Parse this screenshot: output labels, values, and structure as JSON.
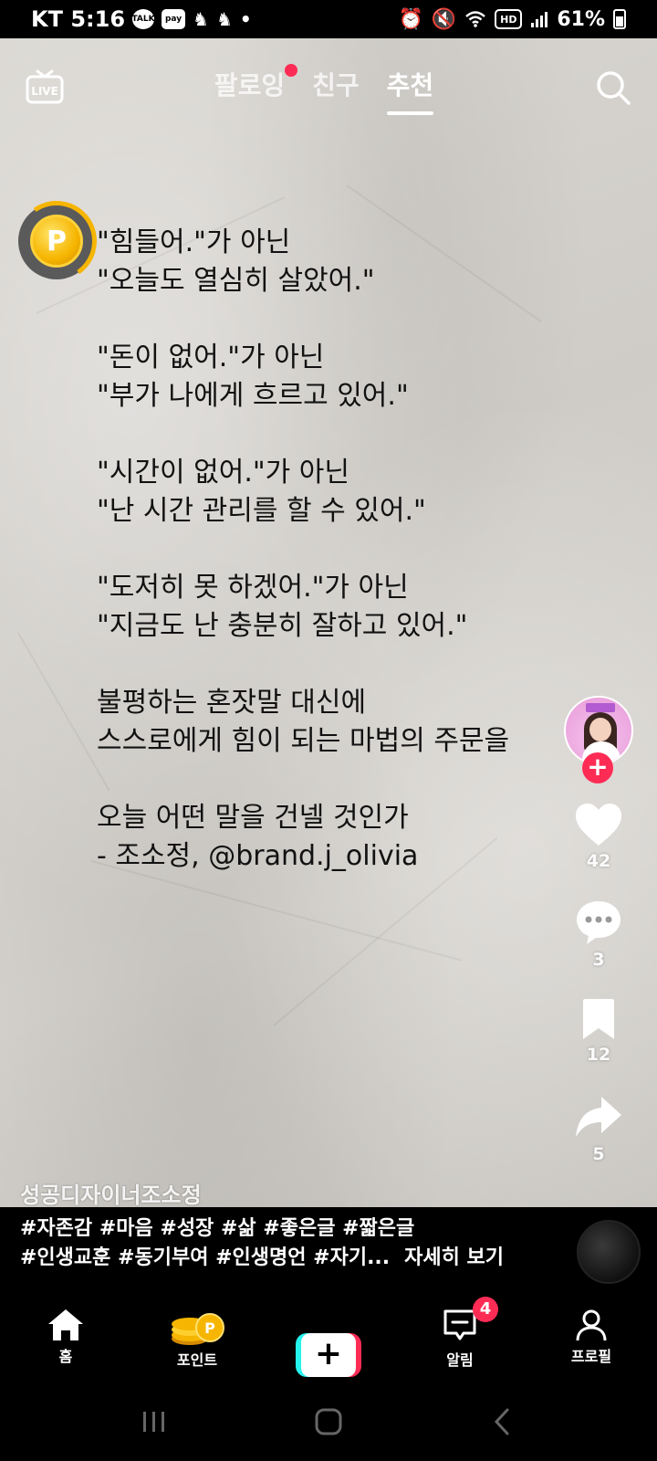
{
  "status_bar": {
    "carrier_time": "KT 5:16",
    "icons_left": [
      "talk-icon",
      "pay-icon",
      "game-icon",
      "game-icon",
      "dot-icon"
    ],
    "talk_label": "TALK",
    "pay_label": "pay",
    "hd_label": "HD",
    "battery_text": "61%"
  },
  "top_nav": {
    "tabs": [
      {
        "label": "팔로잉",
        "active": false,
        "has_dot": true
      },
      {
        "label": "친구",
        "active": false,
        "has_dot": false
      },
      {
        "label": "추천",
        "active": true,
        "has_dot": false
      }
    ],
    "live_label": "LIVE"
  },
  "points_badge": {
    "label": "P"
  },
  "quote_lines": [
    "\"힘들어.\"가 아닌",
    "\"오늘도 열심히 살았어.\"",
    "",
    "\"돈이 없어.\"가 아닌",
    "\"부가 나에게 흐르고 있어.\"",
    "",
    "\"시간이 없어.\"가 아닌",
    "\"난 시간 관리를 할 수 있어.\"",
    "",
    "\"도저히 못 하겠어.\"가 아닌",
    "\"지금도 난 충분히 잘하고 있어.\"",
    "",
    "불평하는 혼잣말 대신에",
    "스스로에게 힘이 되는 마법의 주문을",
    "",
    "오늘 어떤 말을 건넬 것인가",
    "- 조소정, @brand.j_olivia"
  ],
  "actions": {
    "follow_label": "+",
    "likes": "42",
    "comments": "3",
    "bookmarks": "12",
    "shares": "5"
  },
  "author": {
    "name": "성공디자이너조소정"
  },
  "caption": {
    "line1": "#자존감 #마음 #성장 #삶 #좋은글 #짧은글",
    "line2": "#인생교훈 #동기부여 #인생명언 #자기...",
    "see_more": "자세히 보기"
  },
  "bottom_nav": {
    "home": "홈",
    "points": "포인트",
    "create": "+",
    "inbox": "알림",
    "inbox_badge": "4",
    "profile": "프로필"
  },
  "colors": {
    "accent": "#fe2c55",
    "cyan": "#25f4ee",
    "coin": "#f6b500"
  }
}
